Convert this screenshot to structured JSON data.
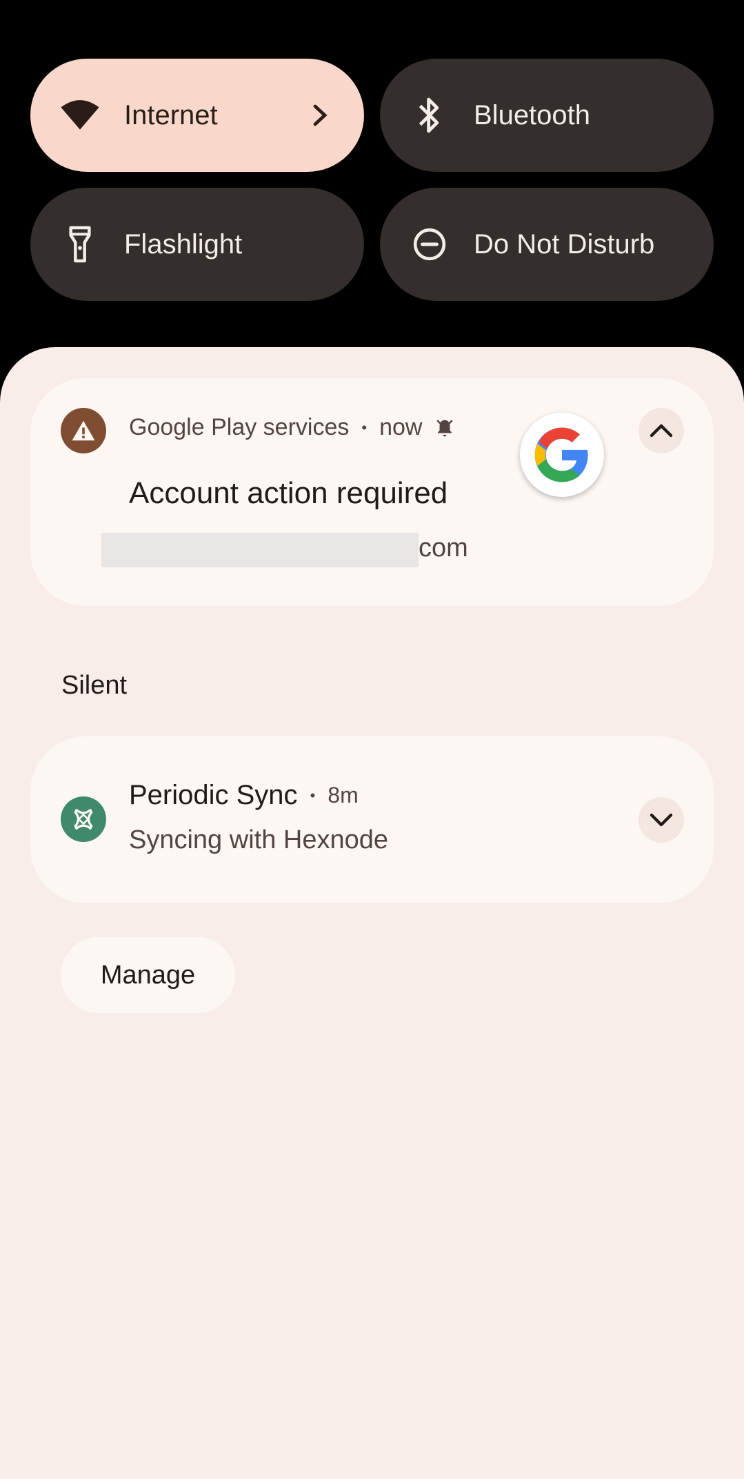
{
  "quick_settings": {
    "internet": {
      "label": "Internet",
      "icon": "wifi-icon",
      "active": true
    },
    "bluetooth": {
      "label": "Bluetooth",
      "icon": "bluetooth-icon",
      "active": false
    },
    "flashlight": {
      "label": "Flashlight",
      "icon": "flashlight-icon",
      "active": false
    },
    "dnd": {
      "label": "Do Not Disturb",
      "icon": "dnd-icon",
      "active": false
    }
  },
  "notifications": {
    "gps": {
      "app": "Google Play services",
      "separator": "•",
      "time": "now",
      "title": "Account action required",
      "email_suffix": "com",
      "icon": "warning-icon"
    },
    "section_label": "Silent",
    "sync": {
      "title": "Periodic Sync",
      "separator": "•",
      "time": "8m",
      "text": "Syncing with Hexnode",
      "icon": "hexnode-icon"
    }
  },
  "manage_label": "Manage",
  "colors": {
    "active_tile": "#f9d8cb",
    "dark_tile": "#342f2d",
    "shade": "#f8ede9",
    "card": "#fdf7f4",
    "gps_icon_bg": "#7f4d32",
    "sync_icon_bg": "#3e8a6a"
  }
}
